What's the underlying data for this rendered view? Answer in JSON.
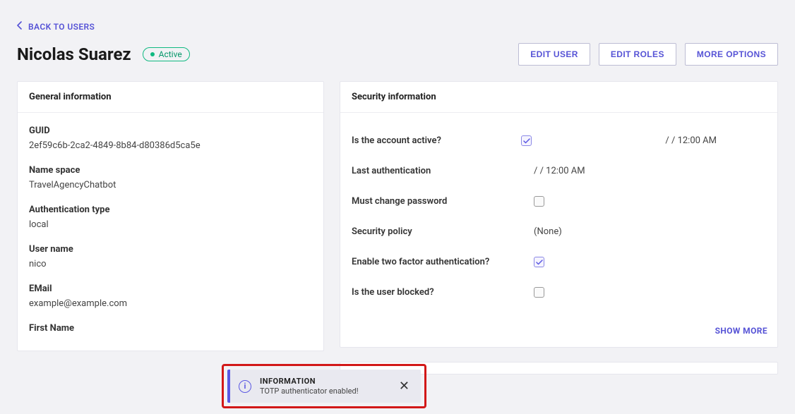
{
  "backLabel": "BACK TO USERS",
  "userName": "Nicolas Suarez",
  "statusLabel": "Active",
  "actions": {
    "edit": "EDIT USER",
    "roles": "EDIT ROLES",
    "more": "MORE OPTIONS"
  },
  "general": {
    "title": "General information",
    "guid": {
      "label": "GUID",
      "value": "2ef59c6b-2ca2-4849-8b84-d80386d5ca5e"
    },
    "namespace": {
      "label": "Name space",
      "value": "TravelAgencyChatbot"
    },
    "authType": {
      "label": "Authentication type",
      "value": "local"
    },
    "username": {
      "label": "User name",
      "value": "nico"
    },
    "email": {
      "label": "EMail",
      "value": "example@example.com"
    },
    "firstName": {
      "label": "First Name"
    }
  },
  "security": {
    "title": "Security information",
    "rows": {
      "active": {
        "label": "Is the account active?",
        "checked": true,
        "extra": "/ / 12:00 AM"
      },
      "lastAuth": {
        "label": "Last authentication",
        "value": "/ / 12:00 AM"
      },
      "mustChange": {
        "label": "Must change password",
        "checked": false
      },
      "policy": {
        "label": "Security policy",
        "value": "(None)"
      },
      "twoFactor": {
        "label": "Enable two factor authentication?",
        "checked": true
      },
      "blocked": {
        "label": "Is the user blocked?",
        "checked": false
      }
    },
    "showMore": "SHOW MORE"
  },
  "toast": {
    "title": "INFORMATION",
    "message": "TOTP authenticator enabled!"
  }
}
